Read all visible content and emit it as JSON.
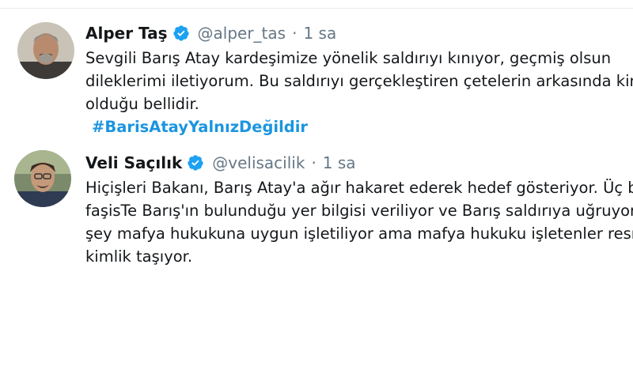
{
  "tweets": [
    {
      "name": "Alper Taş",
      "handle": "@alper_tas",
      "separator": "·",
      "time": "1 sa",
      "lines": [
        "Sevgili Barış Atay kardeşimize yönelik saldırıyı kınıyor, geçmiş olsun",
        "dileklerimi iletiyorum. Bu saldırıyı gerçekleştiren çetelerin arkasında kim",
        "olduğu bellidir."
      ],
      "hashtag": "#BarisAtayYalnızDeğildir",
      "avatar_icon": "user-photo-icon",
      "verified_icon": "verified-badge-icon"
    },
    {
      "name": "Veli Saçılık",
      "handle": "@velisacilik",
      "separator": "·",
      "time": "1 sa",
      "lines": [
        "Hiçişleri Bakanı, Barış Atay'a ağır hakaret ederek hedef gösteriyor. Üç b",
        "faşisTe Barış'ın bulunduğu yer bilgisi veriliyor ve Barış saldırıya uğruyor",
        "şey mafya hukukuna uygun işletiliyor ama mafya hukuku işletenler resm",
        "kimlik taşıyor."
      ],
      "avatar_icon": "user-photo-icon",
      "verified_icon": "verified-badge-icon"
    }
  ],
  "colors": {
    "name": "#14171a",
    "meta": "#657786",
    "hashtag": "#1b95e0",
    "verified": "#1da1f2",
    "divider": "#e6ecf0"
  }
}
